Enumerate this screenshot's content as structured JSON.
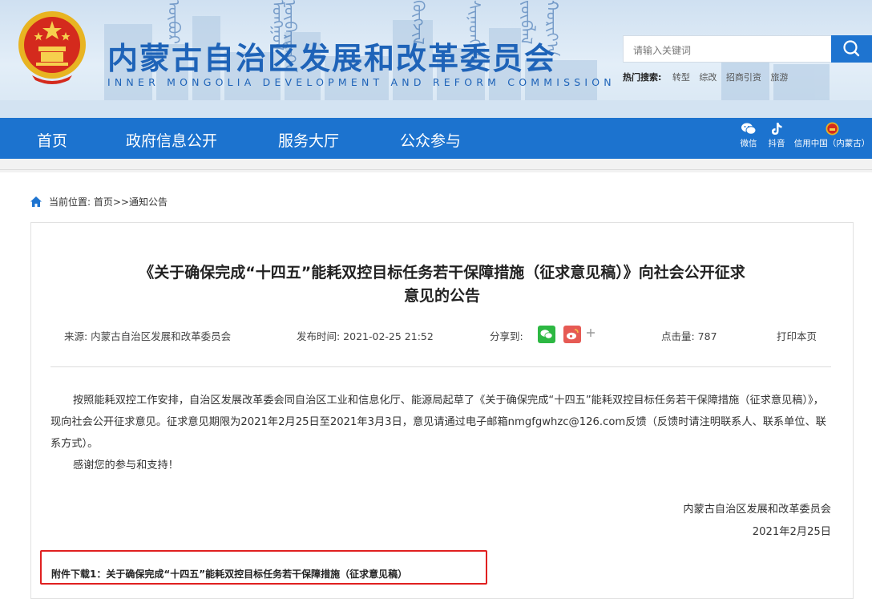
{
  "header": {
    "title": "内蒙古自治区发展和改革委员会",
    "subtitle": "INNER MONGOLIA DEVELOPMENT AND REFORM COMMISSION",
    "search_placeholder": "请输入关键词",
    "hot_label": "热门搜索:",
    "hot_keywords": [
      "转型",
      "综改",
      "招商引资",
      "旅游"
    ]
  },
  "nav": {
    "items": [
      "首页",
      "政府信息公开",
      "服务大厅",
      "公众参与"
    ],
    "right": [
      "微信",
      "抖音",
      "信用中国（内蒙古）"
    ]
  },
  "breadcrumb": {
    "label": "当前位置:",
    "path": "首页>>通知公告"
  },
  "article": {
    "title_line1": "《关于确保完成“十四五”能耗双控目标任务若干保障措施（征求意见稿）》向社会公开征求",
    "title_line2": "意见的公告",
    "source": "来源:  内蒙古自治区发展和改革委员会",
    "publish_time": "发布时间:  2021-02-25 21:52",
    "share_label": "分享到:",
    "clicks": "点击量:  787",
    "print": "打印本页",
    "paragraph1": "按照能耗双控工作安排，自治区发展改革委会同自治区工业和信息化厅、能源局起草了《关于确保完成“十四五”能耗双控目标任务若干保障措施（征求意见稿）》，现向社会公开征求意见。征求意见期限为2021年2月25日至2021年3月3日，意见请通过电子邮箱nmgfgwhzc@126.com反馈（反馈时请注明联系人、联系单位、联系方式）。",
    "paragraph2": "感谢您的参与和支持！",
    "signature": "内蒙古自治区发展和改革委员会",
    "date": "2021年2月25日",
    "attachment": "附件下载1：关于确保完成“十四五”能耗双控目标任务若干保障措施（征求意见稿）"
  },
  "colors": {
    "brand_blue": "#1c73cf",
    "title_blue": "#1e63b8",
    "highlight_red": "#e02020"
  }
}
